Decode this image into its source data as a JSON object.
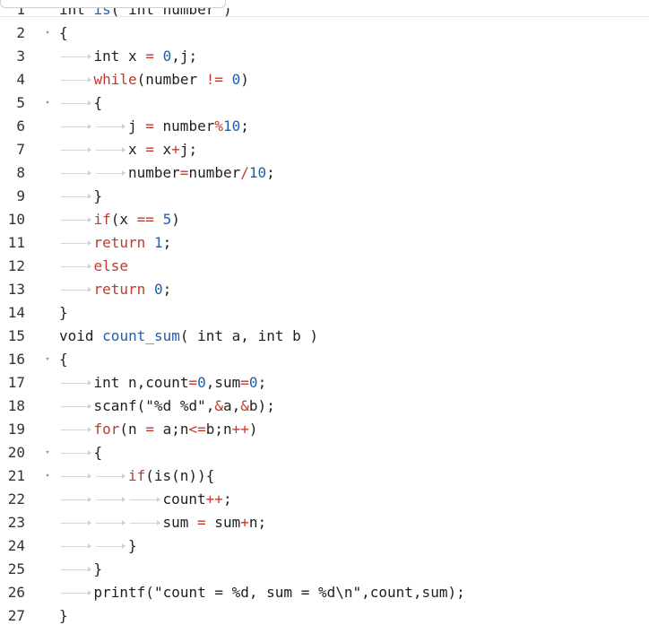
{
  "lines": [
    {
      "n": "1",
      "fold": false,
      "indent": 0,
      "tokens": [
        [
          "kw",
          "int "
        ],
        [
          "fn",
          "is"
        ],
        [
          "kw",
          "( int number )"
        ]
      ]
    },
    {
      "n": "2",
      "fold": true,
      "indent": 0,
      "tokens": [
        [
          "kw",
          "{"
        ]
      ]
    },
    {
      "n": "3",
      "fold": false,
      "indent": 1,
      "tokens": [
        [
          "kw",
          "int x "
        ],
        [
          "op",
          "="
        ],
        [
          "kw",
          " "
        ],
        [
          "num",
          "0"
        ],
        [
          "kw",
          ",j;"
        ]
      ]
    },
    {
      "n": "4",
      "fold": false,
      "indent": 1,
      "tokens": [
        [
          "ctl",
          "while"
        ],
        [
          "kw",
          "(number "
        ],
        [
          "op",
          "!="
        ],
        [
          "kw",
          " "
        ],
        [
          "num",
          "0"
        ],
        [
          "kw",
          ")"
        ]
      ]
    },
    {
      "n": "5",
      "fold": true,
      "indent": 1,
      "tokens": [
        [
          "kw",
          "{"
        ]
      ]
    },
    {
      "n": "6",
      "fold": false,
      "indent": 2,
      "tokens": [
        [
          "kw",
          "j "
        ],
        [
          "op",
          "="
        ],
        [
          "kw",
          " number"
        ],
        [
          "op",
          "%"
        ],
        [
          "num",
          "10"
        ],
        [
          "kw",
          ";"
        ]
      ]
    },
    {
      "n": "7",
      "fold": false,
      "indent": 2,
      "tokens": [
        [
          "kw",
          "x "
        ],
        [
          "op",
          "="
        ],
        [
          "kw",
          " x"
        ],
        [
          "op",
          "+"
        ],
        [
          "kw",
          "j;"
        ]
      ]
    },
    {
      "n": "8",
      "fold": false,
      "indent": 2,
      "tokens": [
        [
          "kw",
          "number"
        ],
        [
          "op",
          "="
        ],
        [
          "kw",
          "number"
        ],
        [
          "op",
          "/"
        ],
        [
          "num",
          "10"
        ],
        [
          "kw",
          ";"
        ]
      ]
    },
    {
      "n": "9",
      "fold": false,
      "indent": 1,
      "tokens": [
        [
          "kw",
          "}"
        ]
      ]
    },
    {
      "n": "10",
      "fold": false,
      "indent": 1,
      "tokens": [
        [
          "ctl",
          "if"
        ],
        [
          "kw",
          "(x "
        ],
        [
          "op",
          "=="
        ],
        [
          "kw",
          " "
        ],
        [
          "num",
          "5"
        ],
        [
          "kw",
          ")"
        ]
      ]
    },
    {
      "n": "11",
      "fold": false,
      "indent": 1,
      "tokens": [
        [
          "ctl",
          "return"
        ],
        [
          "kw",
          " "
        ],
        [
          "num",
          "1"
        ],
        [
          "kw",
          ";"
        ]
      ]
    },
    {
      "n": "12",
      "fold": false,
      "indent": 1,
      "tokens": [
        [
          "ctl",
          "else"
        ]
      ]
    },
    {
      "n": "13",
      "fold": false,
      "indent": 1,
      "tokens": [
        [
          "ctl",
          "return"
        ],
        [
          "kw",
          " "
        ],
        [
          "num",
          "0"
        ],
        [
          "kw",
          ";"
        ]
      ]
    },
    {
      "n": "14",
      "fold": false,
      "indent": 0,
      "tokens": [
        [
          "kw",
          "}"
        ]
      ]
    },
    {
      "n": "15",
      "fold": false,
      "indent": 0,
      "tokens": [
        [
          "kw",
          "void "
        ],
        [
          "fn",
          "count_sum"
        ],
        [
          "kw",
          "( int a, int b )"
        ]
      ]
    },
    {
      "n": "16",
      "fold": true,
      "indent": 0,
      "tokens": [
        [
          "kw",
          "{"
        ]
      ]
    },
    {
      "n": "17",
      "fold": false,
      "indent": 1,
      "tokens": [
        [
          "kw",
          "int n,count"
        ],
        [
          "op",
          "="
        ],
        [
          "num",
          "0"
        ],
        [
          "kw",
          ",sum"
        ],
        [
          "op",
          "="
        ],
        [
          "num",
          "0"
        ],
        [
          "kw",
          ";"
        ]
      ]
    },
    {
      "n": "18",
      "fold": false,
      "indent": 1,
      "tokens": [
        [
          "kw",
          "scanf("
        ],
        [
          "str",
          "\"%d %d\""
        ],
        [
          "kw",
          ","
        ],
        [
          "op",
          "&"
        ],
        [
          "kw",
          "a,"
        ],
        [
          "op",
          "&"
        ],
        [
          "kw",
          "b);"
        ]
      ]
    },
    {
      "n": "19",
      "fold": false,
      "indent": 1,
      "tokens": [
        [
          "ctl",
          "for"
        ],
        [
          "kw",
          "(n "
        ],
        [
          "op",
          "="
        ],
        [
          "kw",
          " a;n"
        ],
        [
          "op",
          "<="
        ],
        [
          "kw",
          "b;n"
        ],
        [
          "op",
          "++"
        ],
        [
          "kw",
          ")"
        ]
      ]
    },
    {
      "n": "20",
      "fold": true,
      "indent": 1,
      "tokens": [
        [
          "kw",
          "{"
        ]
      ]
    },
    {
      "n": "21",
      "fold": true,
      "indent": 2,
      "tokens": [
        [
          "ctl",
          "if"
        ],
        [
          "kw",
          "(is(n)){"
        ]
      ]
    },
    {
      "n": "22",
      "fold": false,
      "indent": 3,
      "tokens": [
        [
          "kw",
          "count"
        ],
        [
          "op",
          "++"
        ],
        [
          "kw",
          ";"
        ]
      ]
    },
    {
      "n": "23",
      "fold": false,
      "indent": 3,
      "tokens": [
        [
          "kw",
          "sum "
        ],
        [
          "op",
          "="
        ],
        [
          "kw",
          " sum"
        ],
        [
          "op",
          "+"
        ],
        [
          "kw",
          "n;"
        ]
      ]
    },
    {
      "n": "24",
      "fold": false,
      "indent": 2,
      "tokens": [
        [
          "kw",
          "}"
        ]
      ]
    },
    {
      "n": "25",
      "fold": false,
      "indent": 1,
      "tokens": [
        [
          "kw",
          "}"
        ]
      ]
    },
    {
      "n": "26",
      "fold": false,
      "indent": 1,
      "tokens": [
        [
          "kw",
          "printf("
        ],
        [
          "str",
          "\"count = %d, sum = %d\\n\""
        ],
        [
          "kw",
          ",count,sum);"
        ]
      ]
    },
    {
      "n": "27",
      "fold": false,
      "indent": 0,
      "tokens": [
        [
          "kw",
          "}"
        ]
      ]
    }
  ],
  "fold_glyph": "▾"
}
